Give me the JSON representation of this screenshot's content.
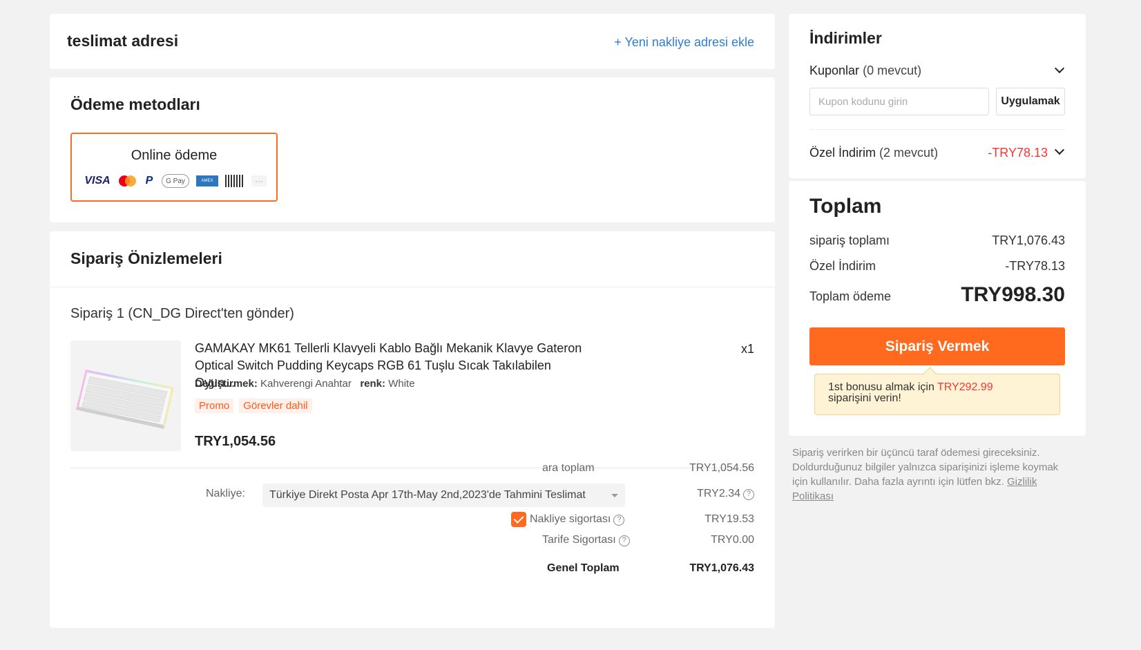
{
  "address": {
    "title": "teslimat adresi",
    "add_link": "+ Yeni nakliye adresi ekle"
  },
  "payment": {
    "title": "Ödeme metodları",
    "option_label": "Online ödeme",
    "methods": [
      "visa",
      "mastercard",
      "paypal",
      "google-pay",
      "amex",
      "boleto",
      "more"
    ],
    "visa_text": "VISA",
    "paypal_text": "P",
    "gpay_text": "G Pay",
    "amex_text": "AMEX",
    "more_text": "···"
  },
  "preview": {
    "title": "Sipariş Önizlemeleri",
    "order_header": "Sipariş 1 (CN_DG Direct'ten gönder)",
    "product": {
      "name": "GAMAKAY MK61 Tellerli Klavyeli Kablo Bağlı Mekanik Klavye Gateron Optical Switch Pudding Keycaps RGB 61 Tuşlu Sıcak Takılabilen Oyun...",
      "quantity": "x1",
      "attr1_label": "Değiştirmek:",
      "attr1_value": "Kahverengi Anahtar",
      "attr2_label": "renk:",
      "attr2_value": "White",
      "tag1": "Promo",
      "tag2": "Görevler dahil",
      "price": "TRY1,054.56"
    },
    "subtotal_label": "ara toplam",
    "subtotal_value": "TRY1,054.56",
    "shipping_label": "Nakliye:",
    "shipping_option": "Türkiye Direkt Posta Apr 17th-May 2nd,2023'de Tahmini Teslimat",
    "shipping_value": "TRY2.34",
    "insurance_label": "Nakliye sigortası",
    "insurance_value": "TRY19.53",
    "insurance_checked": true,
    "tariff_label": "Tarife Sigortası",
    "tariff_value": "TRY0.00",
    "grand_label": "Genel Toplam",
    "grand_value": "TRY1,076.43"
  },
  "discounts": {
    "title": "İndirimler",
    "coupons_label": "Kuponlar",
    "coupons_count": "(0 mevcut)",
    "coupon_placeholder": "Kupon kodunu girin",
    "apply_label": "Uygulamak",
    "special_label": "Özel İndirim",
    "special_count": "(2 mevcut)",
    "special_value": "-TRY78.13"
  },
  "totals": {
    "title": "Toplam",
    "order_total_label": "sipariş toplamı",
    "order_total_value": "TRY1,076.43",
    "special_label": "Özel İndirim",
    "special_value": "-TRY78.13",
    "payable_label": "Toplam ödeme",
    "payable_value": "TRY998.30",
    "place_order": "Sipariş Vermek",
    "bonus_pre": "1st bonusu almak için ",
    "bonus_amount": "TRY292.99",
    "bonus_post": "siparişini verin!"
  },
  "note": {
    "text": "Sipariş verirken bir üçüncü taraf ödemesi gireceksiniz. Doldurduğunuz bilgiler yalnızca siparişinizi işleme koymak için kullanılır. Daha fazla ayrıntı için lütfen bkz. ",
    "link": "Gizlilik Politikası"
  },
  "colors": {
    "accent": "#ff6a1f",
    "link": "#2e7dd8",
    "discount": "#ff3333",
    "page_bg": "#f2f2f2"
  }
}
